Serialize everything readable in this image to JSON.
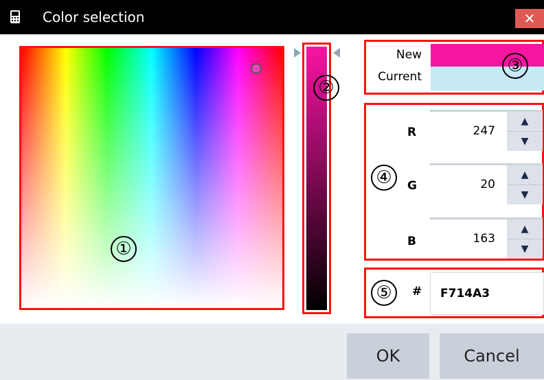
{
  "window": {
    "title": "Color selection",
    "close_glyph": "✕",
    "icon": "calculator-icon"
  },
  "spectrum": {
    "callout": "①",
    "handle_color": "#ee44bb"
  },
  "intensity": {
    "callout": "②",
    "top_color": "#f714a3"
  },
  "preview": {
    "callout": "③",
    "new_label": "New",
    "current_label": "Current",
    "new_color": "#f7149f",
    "current_color": "#c8e8f6"
  },
  "rgb": {
    "callout": "④",
    "channels": [
      {
        "label": "R",
        "value": "247"
      },
      {
        "label": "G",
        "value": "20"
      },
      {
        "label": "B",
        "value": "163"
      }
    ],
    "up_glyph": "▲",
    "down_glyph": "▼"
  },
  "hex": {
    "callout": "⑤",
    "prefix": "#",
    "value": "F714A3"
  },
  "buttons": {
    "ok": "OK",
    "cancel": "Cancel"
  },
  "colors": {
    "highlight": "#ff1010",
    "titlebar": "#000000",
    "close": "#e05a55",
    "footer": "#e8ebf0",
    "button": "#c9d0da"
  }
}
